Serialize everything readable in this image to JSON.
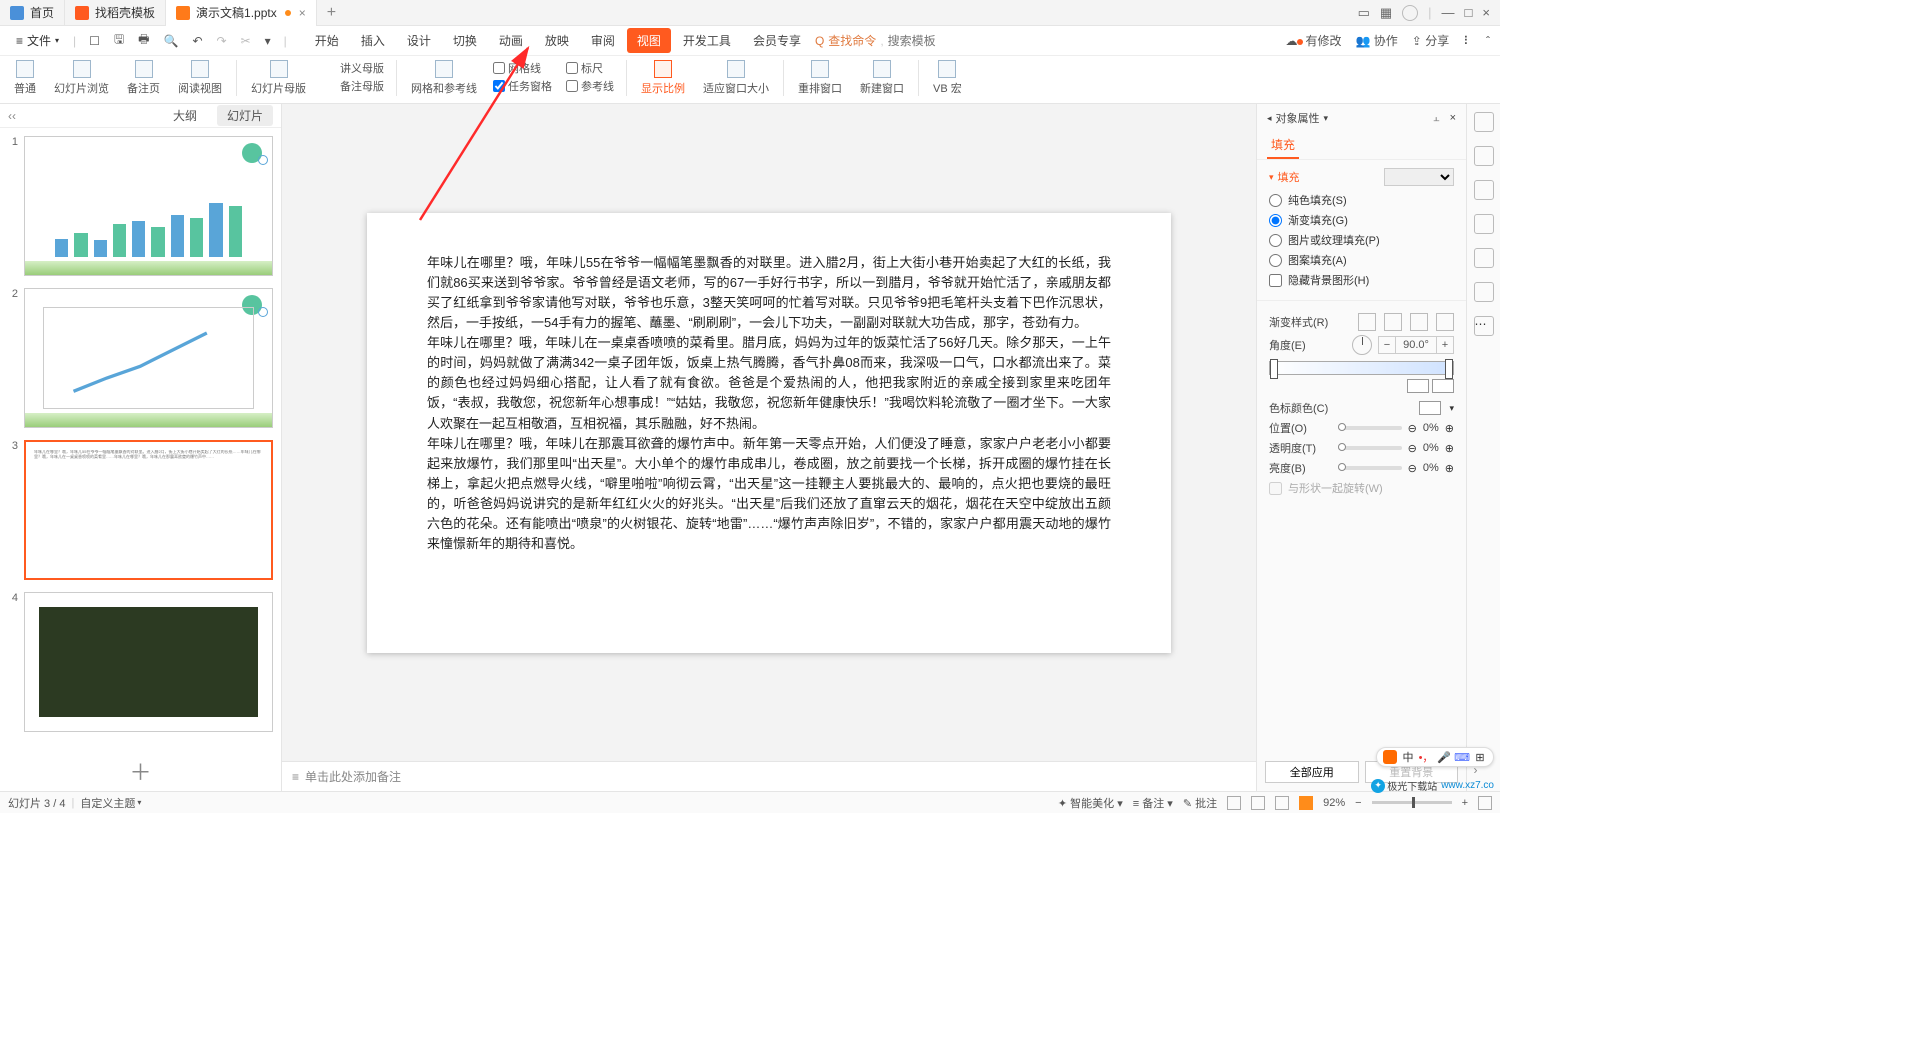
{
  "tabs": {
    "home": "首页",
    "templates": "找稻壳模板",
    "doc": "演示文稿1.pptx"
  },
  "menu": {
    "file": "文件",
    "items": [
      "开始",
      "插入",
      "设计",
      "切换",
      "动画",
      "放映",
      "审阅",
      "视图",
      "开发工具",
      "会员专享"
    ],
    "active_index": 7,
    "search_icon_label": "Q",
    "search_hint": "查找命令",
    "search_placeholder": "搜索模板"
  },
  "topright": {
    "pending": "有修改",
    "coop": "协作",
    "share": "分享"
  },
  "ribbon": {
    "views": {
      "normal": "普通",
      "sorter": "幻灯片浏览",
      "notes": "备注页",
      "reading": "阅读视图"
    },
    "masters": {
      "slide": "幻灯片母版",
      "handout": "讲义母版",
      "notes": "备注母版"
    },
    "grid_btn": "网格和参考线",
    "chk_grid": "网格线",
    "chk_ruler": "标尺",
    "chk_task": "任务窗格",
    "chk_guides": "参考线",
    "scale": "显示比例",
    "fit": "适应窗口大小",
    "rearr": "重排窗口",
    "newwin": "新建窗口",
    "vba": "VB 宏"
  },
  "thumbs": {
    "outline": "大纲",
    "slides": "幻灯片",
    "nums": [
      "1",
      "2",
      "3",
      "4"
    ]
  },
  "slide_body": "年味儿在哪里？哦，年味儿55在爷爷一幅幅笔墨飘香的对联里。进入腊2月，街上大街小巷开始卖起了大红的长纸，我们就86买来送到爷爷家。爷爷曾经是语文老师，写的67一手好行书字，所以一到腊月，爷爷就开始忙活了，亲戚朋友都买了红纸拿到爷爷家请他写对联，爷爷也乐意，3整天笑呵呵的忙着写对联。只见爷爷9把毛笔杆头支着下巴作沉思状，然后，一手按纸，一54手有力的握笔、蘸墨、“刷刷刷”，一会儿下功夫，一副副对联就大功告成，那字，苍劲有力。\n年味儿在哪里？哦，年味儿在一桌桌香喷喷的菜肴里。腊月底，妈妈为过年的饭菜忙活了56好几天。除夕那天，一上午的时间，妈妈就做了满满342一桌子团年饭，饭桌上热气腾腾，香气扑鼻08而来，我深吸一口气，口水都流出来了。菜的颜色也经过妈妈细心搭配，让人看了就有食欲。爸爸是个爱热闹的人，他把我家附近的亲戚全接到家里来吃团年饭，“表叔，我敬您，祝您新年心想事成！”“姑姑，我敬您，祝您新年健康快乐！”我喝饮料轮流敬了一圈才坐下。一大家人欢聚在一起互相敬酒，互相祝福，其乐融融，好不热闹。\n年味儿在哪里？哦，年味儿在那震耳欲聋的爆竹声中。新年第一天零点开始，人们便没了睡意，家家户户老老小小都要起来放爆竹，我们那里叫“出天星”。大小单个的爆竹串成串儿，卷成圈，放之前要找一个长梯，拆开成圈的爆竹挂在长梯上，拿起火把点燃导火线，“噼里啪啦”响彻云霄，“出天星”这一挂鞭主人要挑最大的、最响的，点火把也要烧的最旺的，听爸爸妈妈说讲究的是新年红红火火的好兆头。“出天星”后我们还放了直窜云天的烟花，烟花在天空中绽放出五颜六色的花朵。还有能喷出“喷泉”的火树银花、旋转“地雷”……“爆竹声声除旧岁”，不错的，家家户户都用震天动地的爆竹来憧憬新年的期待和喜悦。",
  "notes_placeholder": "单击此处添加备注",
  "panel": {
    "title": "对象属性",
    "tab_fill": "填充",
    "sec_fill": "填充",
    "fill_none": "纯色填充(S)",
    "fill_grad": "渐变填充(G)",
    "fill_pic": "图片或纹理填充(P)",
    "fill_pat": "图案填充(A)",
    "fill_hide": "隐藏背景图形(H)",
    "grad_style": "渐变样式(R)",
    "angle": "角度(E)",
    "angle_val": "90.0°",
    "color": "色标颜色(C)",
    "pos": "位置(O)",
    "pos_val": "0%",
    "alpha": "透明度(T)",
    "alpha_val": "0%",
    "bright": "亮度(B)",
    "bright_val": "0%",
    "rotate_with": "与形状一起旋转(W)",
    "apply_all": "全部应用",
    "reset": "重置背景"
  },
  "status": {
    "page": "幻灯片 3 / 4",
    "theme": "自定义主题",
    "beautify": "智能美化",
    "notes": "备注",
    "comments": "批注",
    "zoom": "92%"
  },
  "watermark": {
    "text": "极光下载站",
    "url": "www.xz7.co"
  }
}
